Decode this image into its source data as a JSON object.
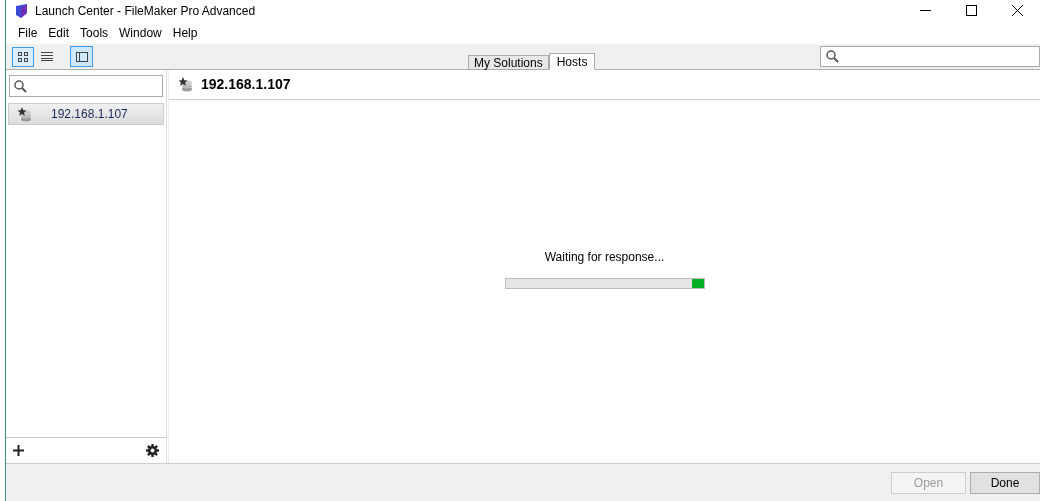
{
  "window": {
    "title": "Launch Center - FileMaker Pro Advanced"
  },
  "menu": [
    "File",
    "Edit",
    "Tools",
    "Window",
    "Help"
  ],
  "toolbar": {
    "view_buttons": [
      {
        "kind": "grid",
        "selected": true
      },
      {
        "kind": "list",
        "selected": false
      }
    ],
    "sidebar_toggle": {
      "on": true
    }
  },
  "tabs": [
    {
      "label": "My Solutions",
      "selected": false
    },
    {
      "label": "Hosts",
      "selected": true
    }
  ],
  "sidebar": {
    "items": [
      {
        "label": "192.168.1.107",
        "selected": true
      }
    ]
  },
  "main": {
    "title": "192.168.1.107",
    "status": "Waiting for response...",
    "progress": {
      "level": 1
    }
  },
  "buttons": [
    {
      "label": "Open",
      "disabled": true
    },
    {
      "label": "Done",
      "disabled": false
    }
  ]
}
